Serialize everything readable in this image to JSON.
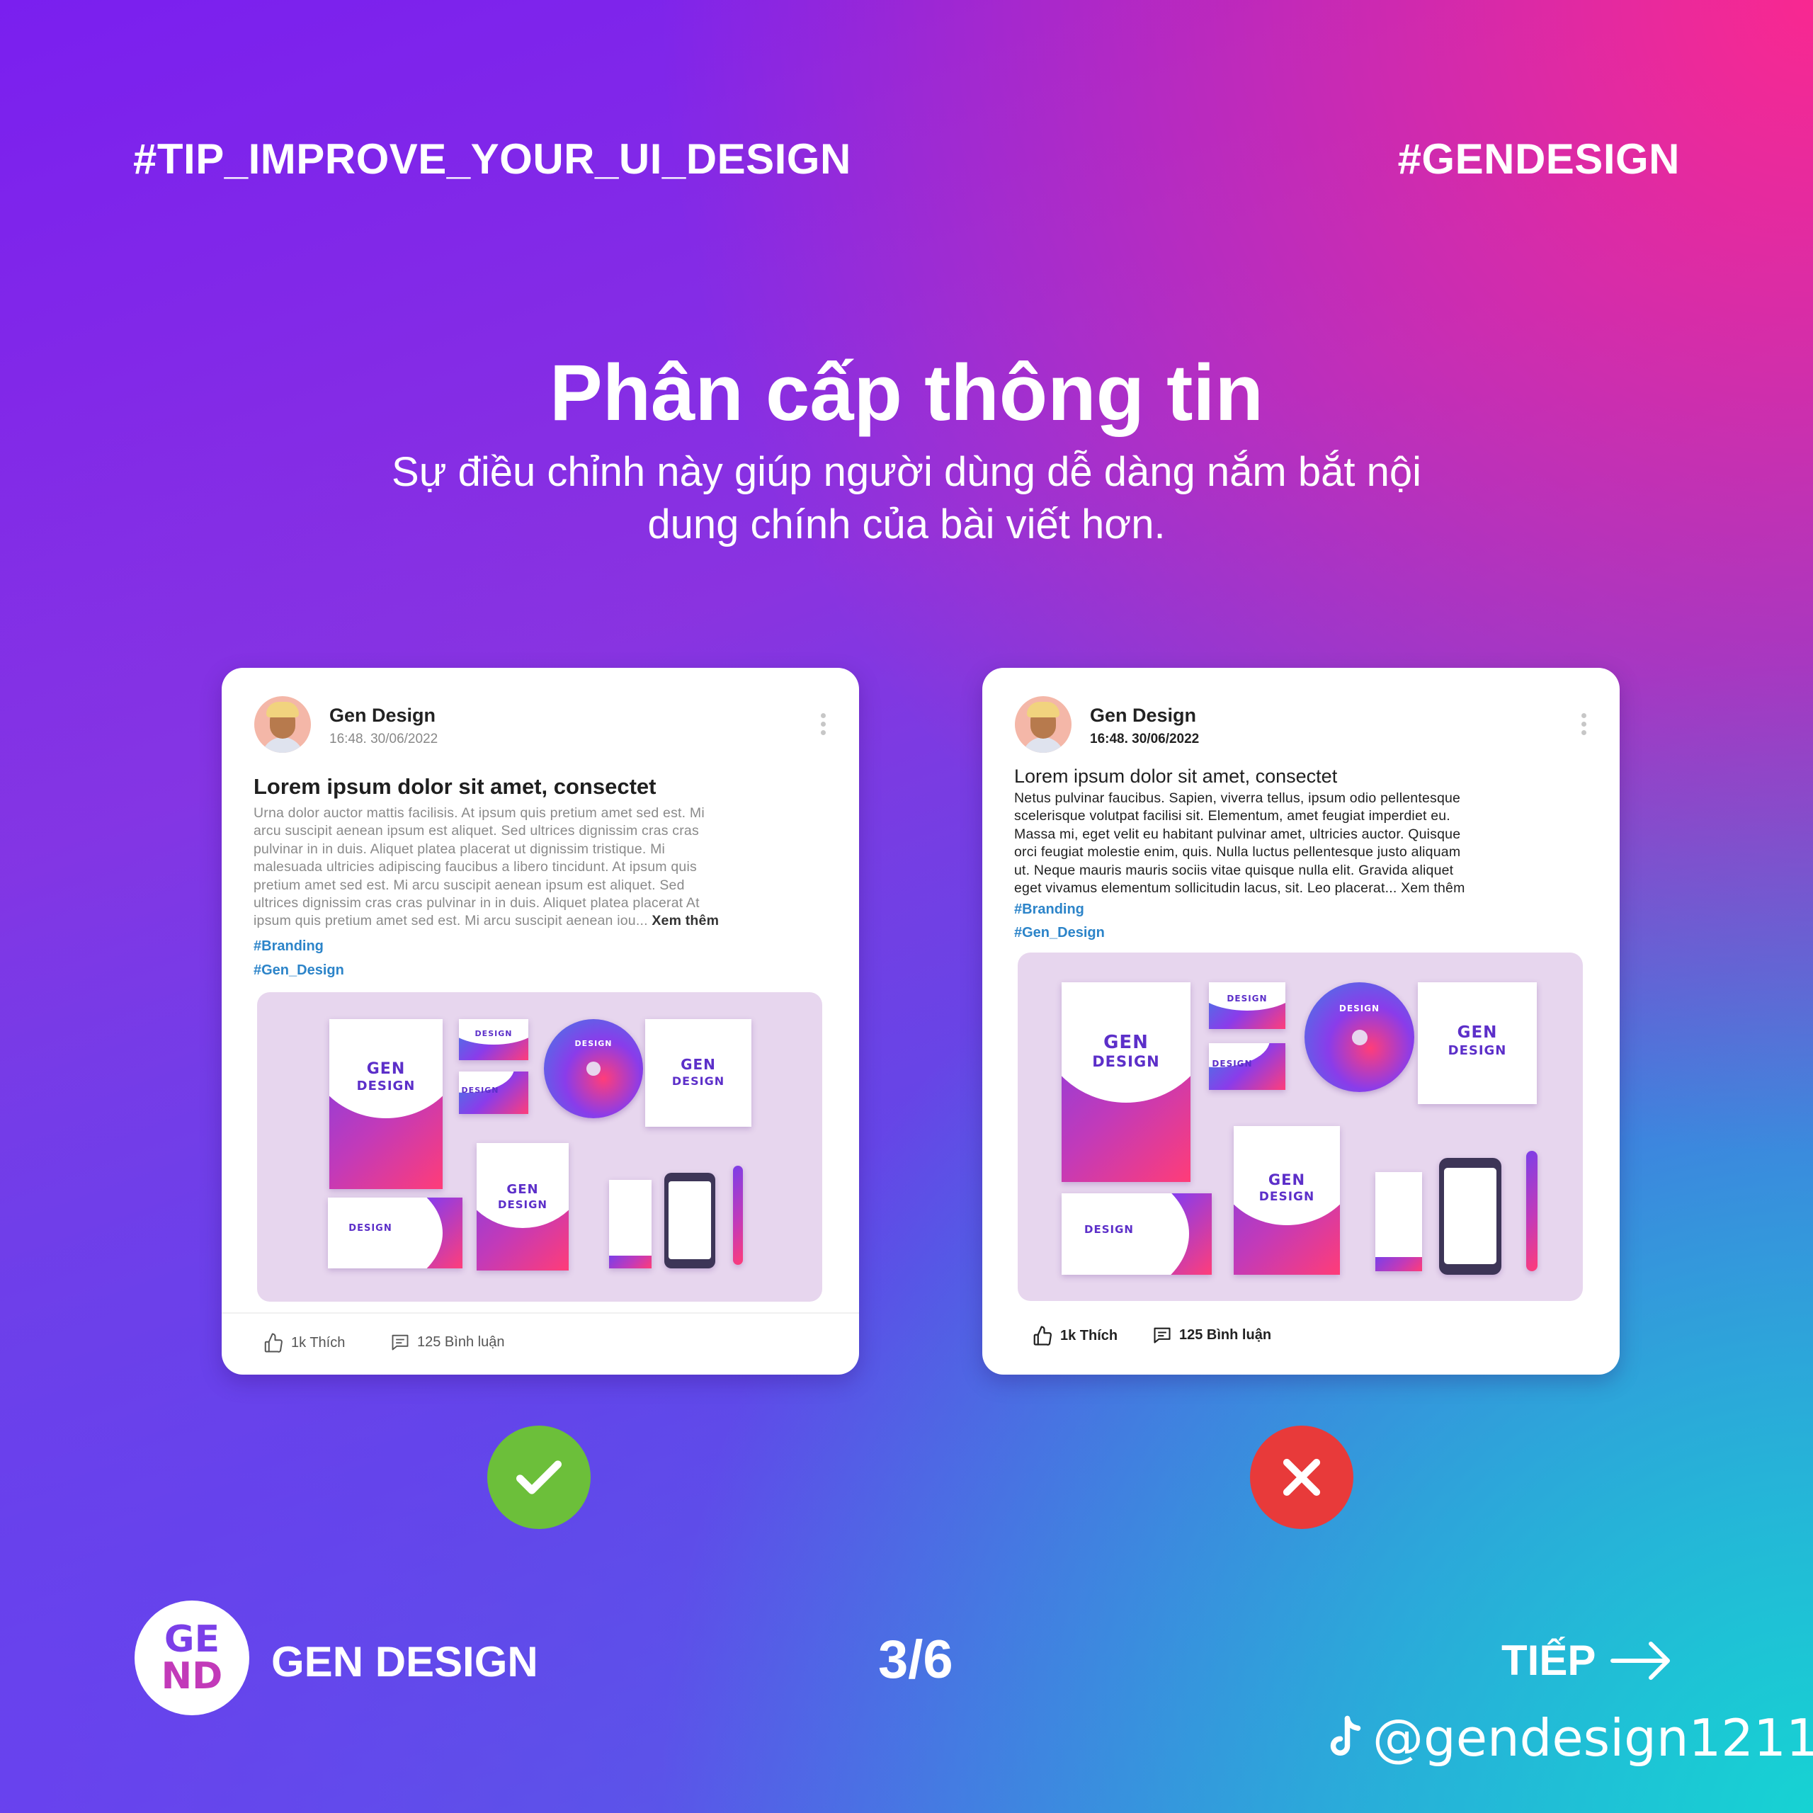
{
  "header": {
    "hashtag_left": "#TIP_IMPROVE_YOUR_UI_DESIGN",
    "hashtag_right": "#GENDESIGN"
  },
  "title": "Phân cấp thông tin",
  "subtitle_line1": "Sự điều chỉnh này giúp người dùng dễ dàng nắm bắt nội",
  "subtitle_line2": "dung chính của bài viết hơn.",
  "good_post": {
    "author": "Gen Design",
    "time": "16:48. 30/06/2022",
    "heading": "Lorem ipsum dolor sit amet, consectet",
    "body_lines": [
      "Urna dolor auctor mattis facilisis. At ipsum quis pretium amet sed est. Mi",
      "arcu suscipit aenean ipsum est aliquet. Sed ultrices dignissim cras cras",
      "pulvinar in in duis. Aliquet platea placerat ut dignissim tristique. Mi",
      "malesuada ultricies adipiscing faucibus a libero tincidunt. At ipsum quis",
      "pretium amet sed est. Mi arcu suscipit aenean ipsum est aliquet. Sed",
      "ultrices dignissim cras cras pulvinar in in duis. Aliquet platea placerat At",
      "ipsum quis pretium amet sed est. Mi arcu suscipit aenean iou..."
    ],
    "see_more": "Xem thêm",
    "tags": [
      "#Branding",
      "#Gen_Design"
    ],
    "likes": "1k Thích",
    "comments": "125 Bình luận",
    "verdict_icon": "check-icon",
    "verdict_color": "#6cbf3a"
  },
  "bad_post": {
    "author": "Gen Design",
    "time": "16:48. 30/06/2022",
    "heading": "Lorem ipsum dolor sit amet, consectet",
    "body_lines": [
      "Netus pulvinar faucibus. Sapien, viverra tellus, ipsum odio pellentesque",
      "scelerisque volutpat facilisi sit. Elementum, amet feugiat imperdiet eu.",
      "Massa mi, eget velit eu habitant pulvinar amet, ultricies auctor. Quisque",
      "orci feugiat molestie enim, quis. Nulla luctus pellentesque justo aliquam",
      "ut. Neque mauris mauris sociis vitae quisque nulla elit. Gravida aliquet",
      "eget vivamus elementum sollicitudin lacus, sit. Leo placerat..."
    ],
    "see_more": "Xem thêm",
    "tags": [
      "#Branding",
      "#Gen_Design"
    ],
    "likes": "1k Thích",
    "comments": "125 Bình luận",
    "verdict_icon": "cross-icon",
    "verdict_color": "#e83a3a"
  },
  "mockup": {
    "logo_line1": "GEN",
    "logo_line2": "DESIGN",
    "small_logo": "GE ND"
  },
  "footer": {
    "logo_text_top": "GE",
    "logo_text_bottom": "ND",
    "brand": "GEN DESIGN",
    "page": "3/6",
    "next": "TIẾP",
    "tiktok_handle": "@gendesign1211"
  },
  "colors": {
    "tag_blue": "#2c84c9",
    "accent_purple": "#5c2fc9"
  }
}
